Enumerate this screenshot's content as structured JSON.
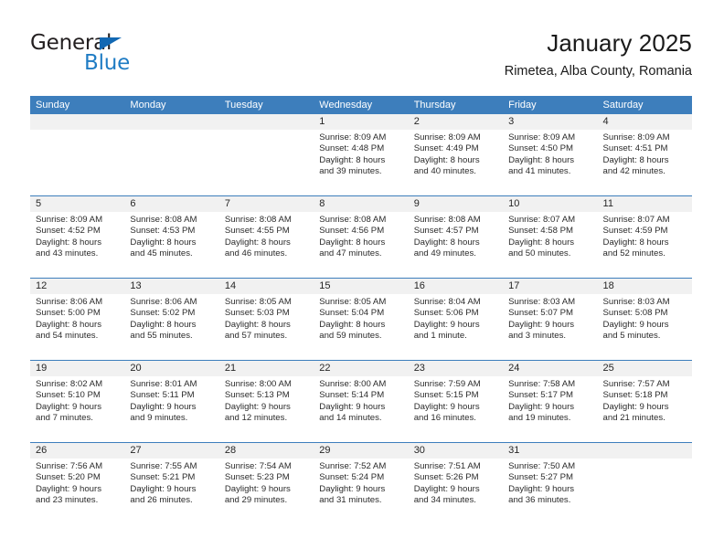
{
  "brand": {
    "name_dark": "General",
    "name_blue": "Blue",
    "triangle_color": "#1268b3",
    "blue_color": "#1f7cc4"
  },
  "header": {
    "title": "January 2025",
    "subtitle": "Rimetea, Alba County, Romania"
  },
  "theme": {
    "header_blue": "#3d7ebc",
    "day_band_gray": "#f1f1f1",
    "text": "#2b2b2b"
  },
  "weekdays": [
    "Sunday",
    "Monday",
    "Tuesday",
    "Wednesday",
    "Thursday",
    "Friday",
    "Saturday"
  ],
  "weeks": [
    [
      {
        "day": "",
        "empty": true
      },
      {
        "day": "",
        "empty": true
      },
      {
        "day": "",
        "empty": true
      },
      {
        "day": "1",
        "sunrise": "Sunrise: 8:09 AM",
        "sunset": "Sunset: 4:48 PM",
        "daylight1": "Daylight: 8 hours",
        "daylight2": "and 39 minutes."
      },
      {
        "day": "2",
        "sunrise": "Sunrise: 8:09 AM",
        "sunset": "Sunset: 4:49 PM",
        "daylight1": "Daylight: 8 hours",
        "daylight2": "and 40 minutes."
      },
      {
        "day": "3",
        "sunrise": "Sunrise: 8:09 AM",
        "sunset": "Sunset: 4:50 PM",
        "daylight1": "Daylight: 8 hours",
        "daylight2": "and 41 minutes."
      },
      {
        "day": "4",
        "sunrise": "Sunrise: 8:09 AM",
        "sunset": "Sunset: 4:51 PM",
        "daylight1": "Daylight: 8 hours",
        "daylight2": "and 42 minutes."
      }
    ],
    [
      {
        "day": "5",
        "sunrise": "Sunrise: 8:09 AM",
        "sunset": "Sunset: 4:52 PM",
        "daylight1": "Daylight: 8 hours",
        "daylight2": "and 43 minutes."
      },
      {
        "day": "6",
        "sunrise": "Sunrise: 8:08 AM",
        "sunset": "Sunset: 4:53 PM",
        "daylight1": "Daylight: 8 hours",
        "daylight2": "and 45 minutes."
      },
      {
        "day": "7",
        "sunrise": "Sunrise: 8:08 AM",
        "sunset": "Sunset: 4:55 PM",
        "daylight1": "Daylight: 8 hours",
        "daylight2": "and 46 minutes."
      },
      {
        "day": "8",
        "sunrise": "Sunrise: 8:08 AM",
        "sunset": "Sunset: 4:56 PM",
        "daylight1": "Daylight: 8 hours",
        "daylight2": "and 47 minutes."
      },
      {
        "day": "9",
        "sunrise": "Sunrise: 8:08 AM",
        "sunset": "Sunset: 4:57 PM",
        "daylight1": "Daylight: 8 hours",
        "daylight2": "and 49 minutes."
      },
      {
        "day": "10",
        "sunrise": "Sunrise: 8:07 AM",
        "sunset": "Sunset: 4:58 PM",
        "daylight1": "Daylight: 8 hours",
        "daylight2": "and 50 minutes."
      },
      {
        "day": "11",
        "sunrise": "Sunrise: 8:07 AM",
        "sunset": "Sunset: 4:59 PM",
        "daylight1": "Daylight: 8 hours",
        "daylight2": "and 52 minutes."
      }
    ],
    [
      {
        "day": "12",
        "sunrise": "Sunrise: 8:06 AM",
        "sunset": "Sunset: 5:00 PM",
        "daylight1": "Daylight: 8 hours",
        "daylight2": "and 54 minutes."
      },
      {
        "day": "13",
        "sunrise": "Sunrise: 8:06 AM",
        "sunset": "Sunset: 5:02 PM",
        "daylight1": "Daylight: 8 hours",
        "daylight2": "and 55 minutes."
      },
      {
        "day": "14",
        "sunrise": "Sunrise: 8:05 AM",
        "sunset": "Sunset: 5:03 PM",
        "daylight1": "Daylight: 8 hours",
        "daylight2": "and 57 minutes."
      },
      {
        "day": "15",
        "sunrise": "Sunrise: 8:05 AM",
        "sunset": "Sunset: 5:04 PM",
        "daylight1": "Daylight: 8 hours",
        "daylight2": "and 59 minutes."
      },
      {
        "day": "16",
        "sunrise": "Sunrise: 8:04 AM",
        "sunset": "Sunset: 5:06 PM",
        "daylight1": "Daylight: 9 hours",
        "daylight2": "and 1 minute."
      },
      {
        "day": "17",
        "sunrise": "Sunrise: 8:03 AM",
        "sunset": "Sunset: 5:07 PM",
        "daylight1": "Daylight: 9 hours",
        "daylight2": "and 3 minutes."
      },
      {
        "day": "18",
        "sunrise": "Sunrise: 8:03 AM",
        "sunset": "Sunset: 5:08 PM",
        "daylight1": "Daylight: 9 hours",
        "daylight2": "and 5 minutes."
      }
    ],
    [
      {
        "day": "19",
        "sunrise": "Sunrise: 8:02 AM",
        "sunset": "Sunset: 5:10 PM",
        "daylight1": "Daylight: 9 hours",
        "daylight2": "and 7 minutes."
      },
      {
        "day": "20",
        "sunrise": "Sunrise: 8:01 AM",
        "sunset": "Sunset: 5:11 PM",
        "daylight1": "Daylight: 9 hours",
        "daylight2": "and 9 minutes."
      },
      {
        "day": "21",
        "sunrise": "Sunrise: 8:00 AM",
        "sunset": "Sunset: 5:13 PM",
        "daylight1": "Daylight: 9 hours",
        "daylight2": "and 12 minutes."
      },
      {
        "day": "22",
        "sunrise": "Sunrise: 8:00 AM",
        "sunset": "Sunset: 5:14 PM",
        "daylight1": "Daylight: 9 hours",
        "daylight2": "and 14 minutes."
      },
      {
        "day": "23",
        "sunrise": "Sunrise: 7:59 AM",
        "sunset": "Sunset: 5:15 PM",
        "daylight1": "Daylight: 9 hours",
        "daylight2": "and 16 minutes."
      },
      {
        "day": "24",
        "sunrise": "Sunrise: 7:58 AM",
        "sunset": "Sunset: 5:17 PM",
        "daylight1": "Daylight: 9 hours",
        "daylight2": "and 19 minutes."
      },
      {
        "day": "25",
        "sunrise": "Sunrise: 7:57 AM",
        "sunset": "Sunset: 5:18 PM",
        "daylight1": "Daylight: 9 hours",
        "daylight2": "and 21 minutes."
      }
    ],
    [
      {
        "day": "26",
        "sunrise": "Sunrise: 7:56 AM",
        "sunset": "Sunset: 5:20 PM",
        "daylight1": "Daylight: 9 hours",
        "daylight2": "and 23 minutes."
      },
      {
        "day": "27",
        "sunrise": "Sunrise: 7:55 AM",
        "sunset": "Sunset: 5:21 PM",
        "daylight1": "Daylight: 9 hours",
        "daylight2": "and 26 minutes."
      },
      {
        "day": "28",
        "sunrise": "Sunrise: 7:54 AM",
        "sunset": "Sunset: 5:23 PM",
        "daylight1": "Daylight: 9 hours",
        "daylight2": "and 29 minutes."
      },
      {
        "day": "29",
        "sunrise": "Sunrise: 7:52 AM",
        "sunset": "Sunset: 5:24 PM",
        "daylight1": "Daylight: 9 hours",
        "daylight2": "and 31 minutes."
      },
      {
        "day": "30",
        "sunrise": "Sunrise: 7:51 AM",
        "sunset": "Sunset: 5:26 PM",
        "daylight1": "Daylight: 9 hours",
        "daylight2": "and 34 minutes."
      },
      {
        "day": "31",
        "sunrise": "Sunrise: 7:50 AM",
        "sunset": "Sunset: 5:27 PM",
        "daylight1": "Daylight: 9 hours",
        "daylight2": "and 36 minutes."
      },
      {
        "day": "",
        "empty": true
      }
    ]
  ]
}
